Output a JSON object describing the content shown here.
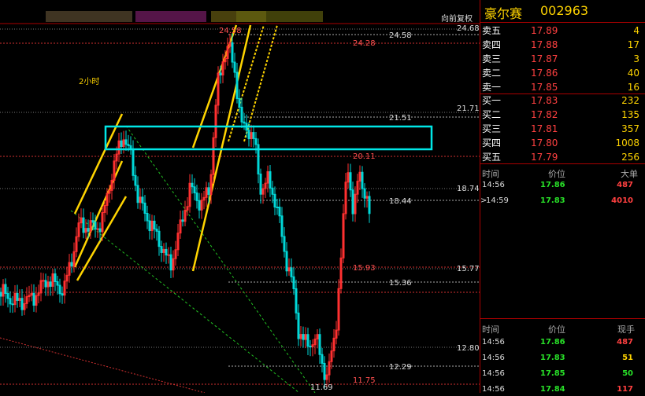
{
  "chart": {
    "restore_label": "向前复权",
    "annotation": "2小时",
    "axis_ticks": [
      "24.68",
      "21.71",
      "18.74",
      "15.77",
      "12.80"
    ],
    "level_labels": [
      "24.58",
      "24.28",
      "24.58",
      "21.51",
      "20.11",
      "18.44",
      "15.93",
      "15.36",
      "12.29",
      "11.75",
      "11.69"
    ]
  },
  "stock": {
    "name": "豪尔赛",
    "code": "002963"
  },
  "order_book": {
    "asks": [
      {
        "label": "卖五",
        "price": "17.89",
        "volume": "4"
      },
      {
        "label": "卖四",
        "price": "17.88",
        "volume": "17"
      },
      {
        "label": "卖三",
        "price": "17.87",
        "volume": "3"
      },
      {
        "label": "卖二",
        "price": "17.86",
        "volume": "40"
      },
      {
        "label": "卖一",
        "price": "17.85",
        "volume": "16"
      }
    ],
    "bids": [
      {
        "label": "买一",
        "price": "17.83",
        "volume": "232"
      },
      {
        "label": "买二",
        "price": "17.82",
        "volume": "135"
      },
      {
        "label": "买三",
        "price": "17.81",
        "volume": "357"
      },
      {
        "label": "买四",
        "price": "17.80",
        "volume": "1008"
      },
      {
        "label": "买五",
        "price": "17.79",
        "volume": "256"
      }
    ]
  },
  "big_orders": {
    "headers": [
      "时间",
      "价位",
      "大单"
    ],
    "rows": [
      {
        "time": "14:56",
        "price": "17.86",
        "volume": "487",
        "marker": ""
      },
      {
        "time": "14:59",
        "price": "17.83",
        "volume": "4010",
        "marker": ">"
      }
    ]
  },
  "ticks": {
    "headers": [
      "时间",
      "价位",
      "现手"
    ],
    "rows": [
      {
        "time": "14:56",
        "price": "17.86",
        "volume": "487"
      },
      {
        "time": "14:56",
        "price": "17.83",
        "volume": "51"
      },
      {
        "time": "14:56",
        "price": "17.85",
        "volume": "50"
      },
      {
        "time": "14:56",
        "price": "17.84",
        "volume": "117"
      }
    ]
  }
}
